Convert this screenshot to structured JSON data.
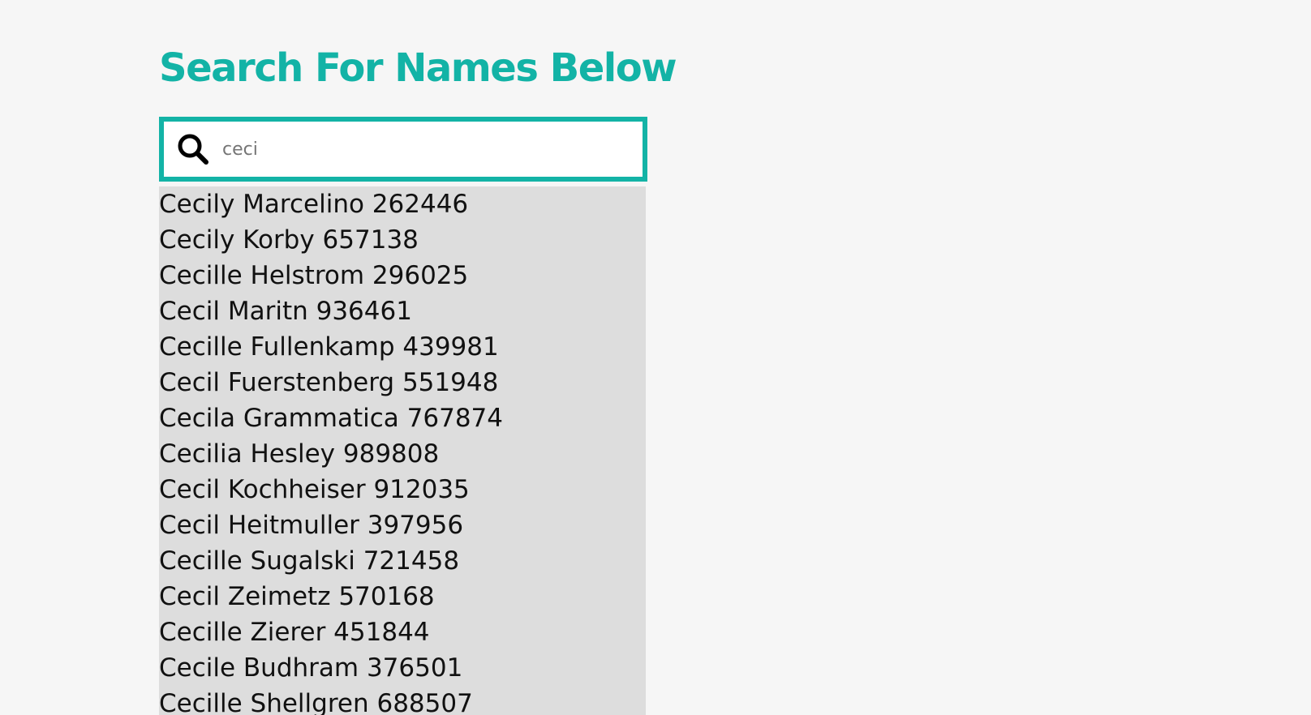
{
  "page": {
    "title": "Search For Names Below",
    "accent_color": "#13b3a6"
  },
  "search": {
    "value": "",
    "placeholder": "ceci",
    "icon": "search-icon"
  },
  "results": [
    {
      "label": "Cecily Marcelino 262446"
    },
    {
      "label": "Cecily Korby 657138"
    },
    {
      "label": "Cecille Helstrom 296025"
    },
    {
      "label": "Cecil Maritn 936461"
    },
    {
      "label": "Cecille Fullenkamp 439981"
    },
    {
      "label": "Cecil Fuerstenberg 551948"
    },
    {
      "label": "Cecila Grammatica 767874"
    },
    {
      "label": "Cecilia Hesley 989808"
    },
    {
      "label": "Cecil Kochheiser 912035"
    },
    {
      "label": "Cecil Heitmuller 397956"
    },
    {
      "label": "Cecille Sugalski 721458"
    },
    {
      "label": "Cecil Zeimetz 570168"
    },
    {
      "label": "Cecille Zierer 451844"
    },
    {
      "label": "Cecile Budhram 376501"
    },
    {
      "label": "Cecille Shellgren 688507"
    }
  ]
}
